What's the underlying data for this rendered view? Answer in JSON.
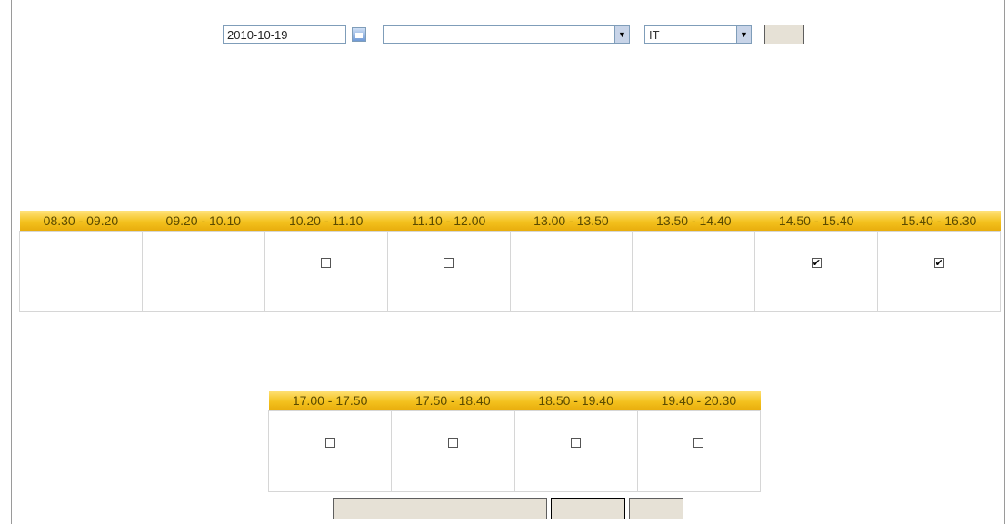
{
  "toolbar": {
    "date_label": "",
    "date_value": "2010-10-19",
    "calendar_icon": "calendar-icon",
    "unit_label": "",
    "unit_value": "",
    "room_label": "",
    "room_value": "IT",
    "submit_label": ""
  },
  "note": "",
  "admin_line": "",
  "date_line": "",
  "in_hours": {
    "heading": "",
    "slots": [
      {
        "time": "08.30 - 09.20",
        "line1": "",
        "line2": "",
        "checkbox": false,
        "checked": false,
        "status": ""
      },
      {
        "time": "09.20 - 10.10",
        "line1": "",
        "line2": "",
        "checkbox": false,
        "checked": false,
        "status": ""
      },
      {
        "time": "10.20 - 11.10",
        "line1": "",
        "line2": "",
        "checkbox": true,
        "checked": false,
        "status": ""
      },
      {
        "time": "11.10 - 12.00",
        "line1": "",
        "line2": "",
        "checkbox": true,
        "checked": false,
        "status": ""
      },
      {
        "time": "13.00 - 13.50",
        "line1": "",
        "line2": "",
        "checkbox": false,
        "checked": false,
        "status": ""
      },
      {
        "time": "13.50 - 14.40",
        "line1": "",
        "line2": "",
        "checkbox": false,
        "checked": false,
        "status": ""
      },
      {
        "time": "14.50 - 15.40",
        "line1": "",
        "line2": "",
        "checkbox": true,
        "checked": true,
        "status": ""
      },
      {
        "time": "15.40 - 16.30",
        "line1": "",
        "line2": "",
        "checkbox": true,
        "checked": true,
        "status": ""
      }
    ]
  },
  "out_hours": {
    "heading": "",
    "slots": [
      {
        "time": "17.00 - 17.50",
        "checkbox": true,
        "checked": false,
        "status": ""
      },
      {
        "time": "17.50 - 18.40",
        "checkbox": true,
        "checked": false,
        "status": ""
      },
      {
        "time": "18.50 - 19.40",
        "checkbox": true,
        "checked": false,
        "status": ""
      },
      {
        "time": "19.40 - 20.30",
        "checkbox": true,
        "checked": false,
        "status": ""
      }
    ]
  },
  "actions": {
    "select_all_label": "",
    "book_label": "",
    "cancel_label": ""
  },
  "colors": {
    "header_gold": "#f4c21f",
    "note_red": "#e0001b",
    "button_beige": "#e6e1d6"
  }
}
